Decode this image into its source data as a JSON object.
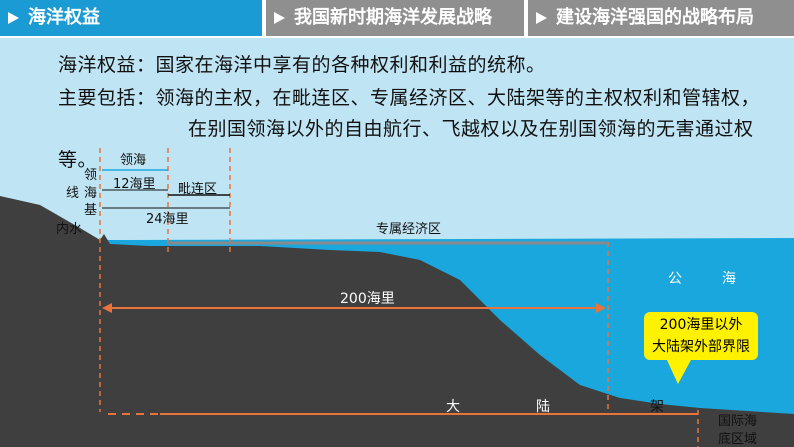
{
  "tabs": [
    {
      "label": "海洋权益",
      "active": true
    },
    {
      "label": "我国新时期海洋发展战略",
      "active": false
    },
    {
      "label": "建设海洋强国的战略布局",
      "active": false
    }
  ],
  "definition": {
    "term_label": "海洋权益",
    "term_colon": "：国家在海洋中享有的各种权利和利益的统称。",
    "scope_label": "主要包括",
    "scope_line1": "：领海的主权，在毗连区、专属经济区、大陆架等的主权权利和管辖权，",
    "scope_line2": "在别国领海以外的自由航行、飞越权以及在别国领海的无害通过权",
    "scope_line3": "等。"
  },
  "diagram": {
    "baseline_label_1": "领",
    "baseline_label_2": "海",
    "baseline_label_3": "基",
    "baseline_label_0": "线",
    "territorial_sea": "领海",
    "nm12": "12海里",
    "contiguous_zone": "毗连区",
    "nm24": "24海里",
    "internal_waters": "内水",
    "eez": "专属经济区",
    "high_seas_1": "公",
    "high_seas_2": "海",
    "nm200": "200海里",
    "shelf_1": "大",
    "shelf_2": "陆",
    "shelf_3": "架",
    "seabed_1": "国际海",
    "seabed_2": "底区域",
    "callout_line1": "200海里以外",
    "callout_line2": "大陆架外部界限"
  },
  "colors": {
    "tab_active": "#1a9bd4",
    "tab_inactive": "#8f8f8f",
    "sky": "#bfe4f3",
    "sea": "#1aa7dd",
    "land": "#3f3f3f",
    "callout": "#fff200",
    "dashed_marker": "#e8743b"
  }
}
